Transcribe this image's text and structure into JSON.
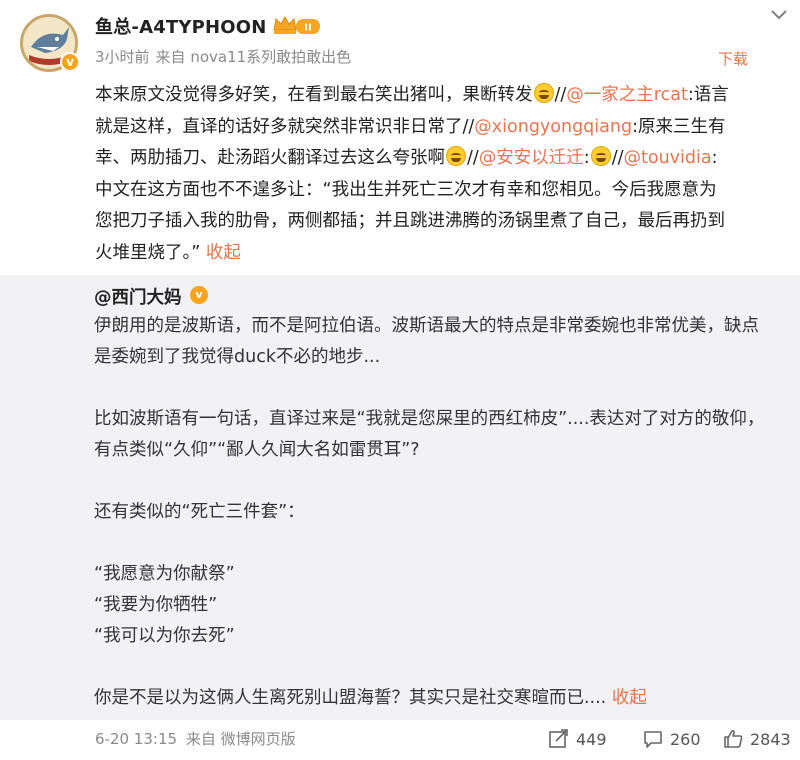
{
  "post": {
    "author": "鱼总-A4TYPHOON",
    "vip_level": "II",
    "time": "3小时前",
    "source": "来自 nova11系列敢拍敢出色",
    "download_label": "下载",
    "text": {
      "l1_a": "本来原文没觉得多好笑，在看到最右笑出猪叫，果断转发",
      "l1_b": "//",
      "l1_mention": "@一家之主rcat",
      "l1_c": ":语言",
      "l2_a": "就是这样，直译的话好多就突然非常识非日常了//",
      "l2_mention": "@xiongyongqiang",
      "l2_b": ":原来三生有",
      "l3_a": "幸、两肋插刀、赴汤蹈火翻译过去这么夸张啊",
      "l3_b": "//",
      "l3_mention1": "@安安以迁迁",
      "l3_c": ":",
      "l3_d": "//",
      "l3_mention2": "@touvidia",
      "l3_e": ":",
      "l4": "中文在这方面也不不遑多让：“我出生并死亡三次才有幸和您相见。今后我愿意为",
      "l5": "您把刀子插入我的肋骨，两侧都插；并且跳进沸腾的汤锅里煮了自己，最后再扔到",
      "l6": "火堆里烧了。”",
      "collapse": "收起"
    }
  },
  "retweet": {
    "author": "@西门大妈",
    "badge": "v",
    "lines": [
      "伊朗用的是波斯语，而不是阿拉伯语。波斯语最大的特点是非常委婉也非常优美，缺点",
      "是委婉到了我觉得duck不必的地步...",
      "",
      "比如波斯语有一句话，直译过来是“我就是您屎里的西红柿皮”....表达对了对方的敬仰，",
      "有点类似“久仰”“鄙人久闻大名如雷贯耳”?",
      "",
      "还有类似的“死亡三件套”：",
      "",
      "“我愿意为你献祭”",
      "“我要为你牺牲”",
      "“我可以为你去死”",
      "",
      "你是不是以为这俩人生离死别山盟海誓？其实只是社交寒暄而已...."
    ],
    "collapse": "收起"
  },
  "footer": {
    "date": "6-20 13:15",
    "source": "来自 微博网页版",
    "reposts": "449",
    "comments": "260",
    "likes": "2843"
  },
  "colors": {
    "accent": "#eb7350",
    "retweet_bg": "#f2f2f5",
    "meta": "#8a8a8a"
  },
  "icons": [
    "shark-avatar-icon",
    "vip-crown-icon",
    "chevron-down-icon",
    "laughing-emoji-icon",
    "grin-emoji-icon",
    "repost-icon",
    "comment-icon",
    "like-icon"
  ]
}
